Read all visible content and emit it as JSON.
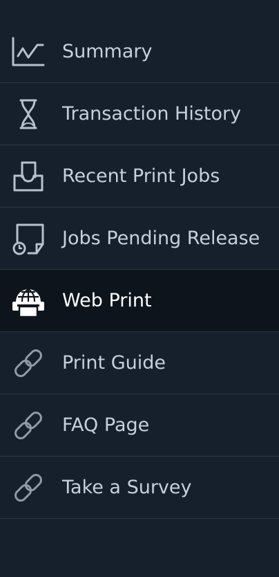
{
  "sidebar": {
    "items": [
      {
        "label": "Summary",
        "icon": "chart-line-icon",
        "active": false
      },
      {
        "label": "Transaction History",
        "icon": "hourglass-icon",
        "active": false
      },
      {
        "label": "Recent Print Jobs",
        "icon": "printer-tray-icon",
        "active": false
      },
      {
        "label": "Jobs Pending Release",
        "icon": "clock-page-icon",
        "active": false
      },
      {
        "label": "Web Print",
        "icon": "globe-printer-icon",
        "active": true
      },
      {
        "label": "Print Guide",
        "icon": "link-icon",
        "active": false
      },
      {
        "label": "FAQ Page",
        "icon": "link-icon",
        "active": false
      },
      {
        "label": "Take a Survey",
        "icon": "link-icon",
        "active": false
      }
    ]
  },
  "colors": {
    "background": "#16202d",
    "active_background": "#0d141c",
    "text": "#c8d0d9",
    "active_text": "#ffffff",
    "divider": "#2b3746"
  }
}
